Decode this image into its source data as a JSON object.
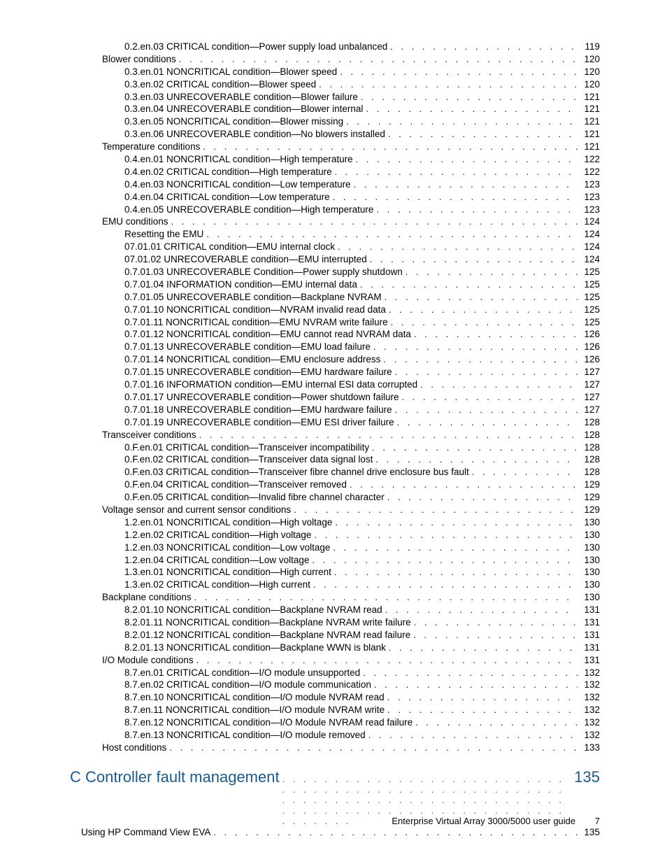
{
  "entries": [
    {
      "indent": 2,
      "title": "0.2.en.03 CRITICAL condition—Power supply load unbalanced",
      "page": "119"
    },
    {
      "indent": 1,
      "title": "Blower conditions",
      "page": "120"
    },
    {
      "indent": 2,
      "title": "0.3.en.01 NONCRITICAL condition—Blower speed",
      "page": "120"
    },
    {
      "indent": 2,
      "title": "0.3.en.02 CRITICAL condition—Blower speed",
      "page": "120"
    },
    {
      "indent": 2,
      "title": "0.3.en.03 UNRECOVERABLE condition—Blower failure",
      "page": "121"
    },
    {
      "indent": 2,
      "title": "0.3.en.04 UNRECOVERABLE condition—Blower internal",
      "page": "121"
    },
    {
      "indent": 2,
      "title": "0.3.en.05 NONCRITICAL condition—Blower missing",
      "page": "121"
    },
    {
      "indent": 2,
      "title": "0.3.en.06 UNRECOVERABLE condition—No blowers installed",
      "page": "121"
    },
    {
      "indent": 1,
      "title": "Temperature conditions",
      "page": "121"
    },
    {
      "indent": 2,
      "title": "0.4.en.01 NONCRITICAL condition—High temperature",
      "page": "122"
    },
    {
      "indent": 2,
      "title": "0.4.en.02 CRITICAL condition—High temperature",
      "page": "122"
    },
    {
      "indent": 2,
      "title": "0.4.en.03 NONCRITICAL condition—Low temperature",
      "page": "123"
    },
    {
      "indent": 2,
      "title": "0.4.en.04 CRITICAL condition—Low temperature",
      "page": "123"
    },
    {
      "indent": 2,
      "title": "0.4.en.05 UNRECOVERABLE condition—High temperature",
      "page": "123"
    },
    {
      "indent": 1,
      "title": "EMU conditions",
      "page": "124"
    },
    {
      "indent": 2,
      "title": "Resetting the EMU",
      "page": "124"
    },
    {
      "indent": 2,
      "title": "07.01.01 CRITICAL condition—EMU internal clock",
      "page": "124"
    },
    {
      "indent": 2,
      "title": "07.01.02 UNRECOVERABLE condition—EMU interrupted",
      "page": "124"
    },
    {
      "indent": 2,
      "title": "0.7.01.03 UNRECOVERABLE Condition—Power supply shutdown",
      "page": "125"
    },
    {
      "indent": 2,
      "title": "0.7.01.04 INFORMATION condition—EMU internal data",
      "page": "125"
    },
    {
      "indent": 2,
      "title": "0.7.01.05 UNRECOVERABLE condition—Backplane NVRAM",
      "page": "125"
    },
    {
      "indent": 2,
      "title": "0.7.01.10 NONCRITICAL condition—NVRAM invalid read data",
      "page": "125"
    },
    {
      "indent": 2,
      "title": "0.7.01.11 NONCRITICAL condition—EMU NVRAM write failure",
      "page": "125"
    },
    {
      "indent": 2,
      "title": "0.7.01.12 NONCRITICAL condition—EMU cannot read NVRAM data",
      "page": "126"
    },
    {
      "indent": 2,
      "title": "0.7.01.13 UNRECOVERABLE condition—EMU load failure",
      "page": "126"
    },
    {
      "indent": 2,
      "title": "0.7.01.14 NONCRITICAL condition—EMU enclosure address",
      "page": "126"
    },
    {
      "indent": 2,
      "title": "0.7.01.15 UNRECOVERABLE condition—EMU hardware failure",
      "page": "127"
    },
    {
      "indent": 2,
      "title": "0.7.01.16 INFORMATION condition—EMU internal ESI data corrupted",
      "page": "127"
    },
    {
      "indent": 2,
      "title": "0.7.01.17 UNRECOVERABLE condition—Power shutdown failure",
      "page": "127"
    },
    {
      "indent": 2,
      "title": "0.7.01.18 UNRECOVERABLE condition—EMU hardware failure",
      "page": "127"
    },
    {
      "indent": 2,
      "title": "0.7.01.19 UNRECOVERABLE condition—EMU ESI driver failure",
      "page": "128"
    },
    {
      "indent": 1,
      "title": "Transceiver conditions",
      "page": "128"
    },
    {
      "indent": 2,
      "title": "0.F.en.01 CRITICAL condition—Transceiver incompatibility",
      "page": "128"
    },
    {
      "indent": 2,
      "title": "0.F.en.02 CRITICAL condition—Transceiver data signal lost",
      "page": "128"
    },
    {
      "indent": 2,
      "title": "0.F.en.03 CRITICAL condition—Transceiver fibre channel drive enclosure bus fault",
      "page": "128"
    },
    {
      "indent": 2,
      "title": "0.F.en.04 CRITICAL condition—Transceiver removed",
      "page": "129"
    },
    {
      "indent": 2,
      "title": "0.F.en.05 CRITICAL condition—Invalid fibre channel character",
      "page": "129"
    },
    {
      "indent": 1,
      "title": "Voltage sensor and current sensor conditions",
      "page": "129"
    },
    {
      "indent": 2,
      "title": "1.2.en.01 NONCRITICAL condition—High voltage",
      "page": "130"
    },
    {
      "indent": 2,
      "title": "1.2.en.02 CRITICAL condition—High voltage",
      "page": "130"
    },
    {
      "indent": 2,
      "title": "1.2.en.03 NONCRITICAL condition—Low voltage",
      "page": "130"
    },
    {
      "indent": 2,
      "title": "1.2.en.04 CRITICAL condition—Low voltage",
      "page": "130"
    },
    {
      "indent": 2,
      "title": "1.3.en.01 NONCRITICAL condition—High current",
      "page": "130"
    },
    {
      "indent": 2,
      "title": "1.3.en.02 CRITICAL condition—High current",
      "page": "130"
    },
    {
      "indent": 1,
      "title": "Backplane conditions",
      "page": "130"
    },
    {
      "indent": 2,
      "title": "8.2.01.10 NONCRITICAL condition—Backplane NVRAM read",
      "page": "131"
    },
    {
      "indent": 2,
      "title": "8.2.01.11 NONCRITICAL condition—Backplane NVRAM write failure",
      "page": "131"
    },
    {
      "indent": 2,
      "title": "8.2.01.12 NONCRITICAL condition—Backplane NVRAM read failure",
      "page": "131"
    },
    {
      "indent": 2,
      "title": "8.2.01.13 NONCRITICAL condition—Backplane WWN is blank",
      "page": "131"
    },
    {
      "indent": 1,
      "title": "I/O Module conditions",
      "page": "131"
    },
    {
      "indent": 2,
      "title": "8.7.en.01 CRITICAL condition—I/O module unsupported",
      "page": "132"
    },
    {
      "indent": 2,
      "title": "8.7.en.02 CRITICAL condition—I/O module communication",
      "page": "132"
    },
    {
      "indent": 2,
      "title": "8.7.en.10 NONCRITICAL condition—I/O module NVRAM read",
      "page": "132"
    },
    {
      "indent": 2,
      "title": "8.7.en.11 NONCRITICAL condition—I/O module NVRAM write",
      "page": "132"
    },
    {
      "indent": 2,
      "title": "8.7.en.12 NONCRITICAL condition—I/O Module NVRAM read failure",
      "page": "132"
    },
    {
      "indent": 2,
      "title": "8.7.en.13 NONCRITICAL condition—I/O module removed",
      "page": "132"
    },
    {
      "indent": 1,
      "title": "Host conditions",
      "page": "133"
    }
  ],
  "chapter": {
    "title": "C Controller fault management",
    "page": "135"
  },
  "chapter_sub": [
    {
      "indent": "sub1",
      "title": "Using HP Command View EVA",
      "page": "135"
    }
  ],
  "footer": {
    "text": "Enterprise Virtual Array 3000/5000 user guide",
    "page": "7"
  }
}
